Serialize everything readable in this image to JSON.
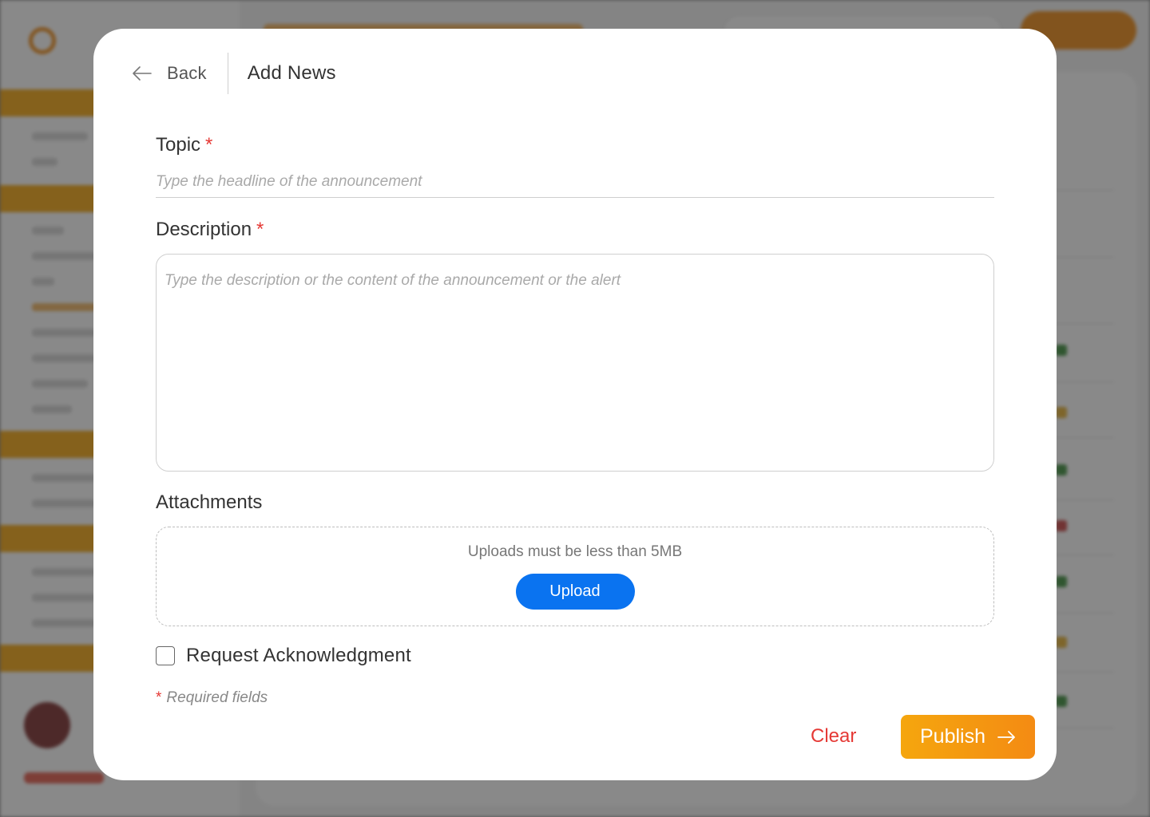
{
  "header": {
    "back_label": "Back",
    "title": "Add News"
  },
  "form": {
    "topic": {
      "label": "Topic",
      "required_marker": "*",
      "placeholder": "Type the headline of the announcement",
      "value": ""
    },
    "description": {
      "label": "Description",
      "required_marker": "*",
      "placeholder": "Type the description or the content of the announcement or the alert",
      "value": ""
    },
    "attachments": {
      "label": "Attachments",
      "hint": "Uploads must be less than 5MB",
      "upload_label": "Upload"
    },
    "acknowledgment": {
      "label": "Request Acknowledgment",
      "checked": false
    },
    "required_note": {
      "marker": "*",
      "text": "Required fields"
    }
  },
  "actions": {
    "clear_label": "Clear",
    "publish_label": "Publish"
  },
  "icons": {
    "back": "arrow-left-icon",
    "publish": "arrow-right-icon"
  },
  "colors": {
    "accent_orange": "#f5a60e",
    "upload_blue": "#0a73f0",
    "danger_red": "#e53935"
  }
}
